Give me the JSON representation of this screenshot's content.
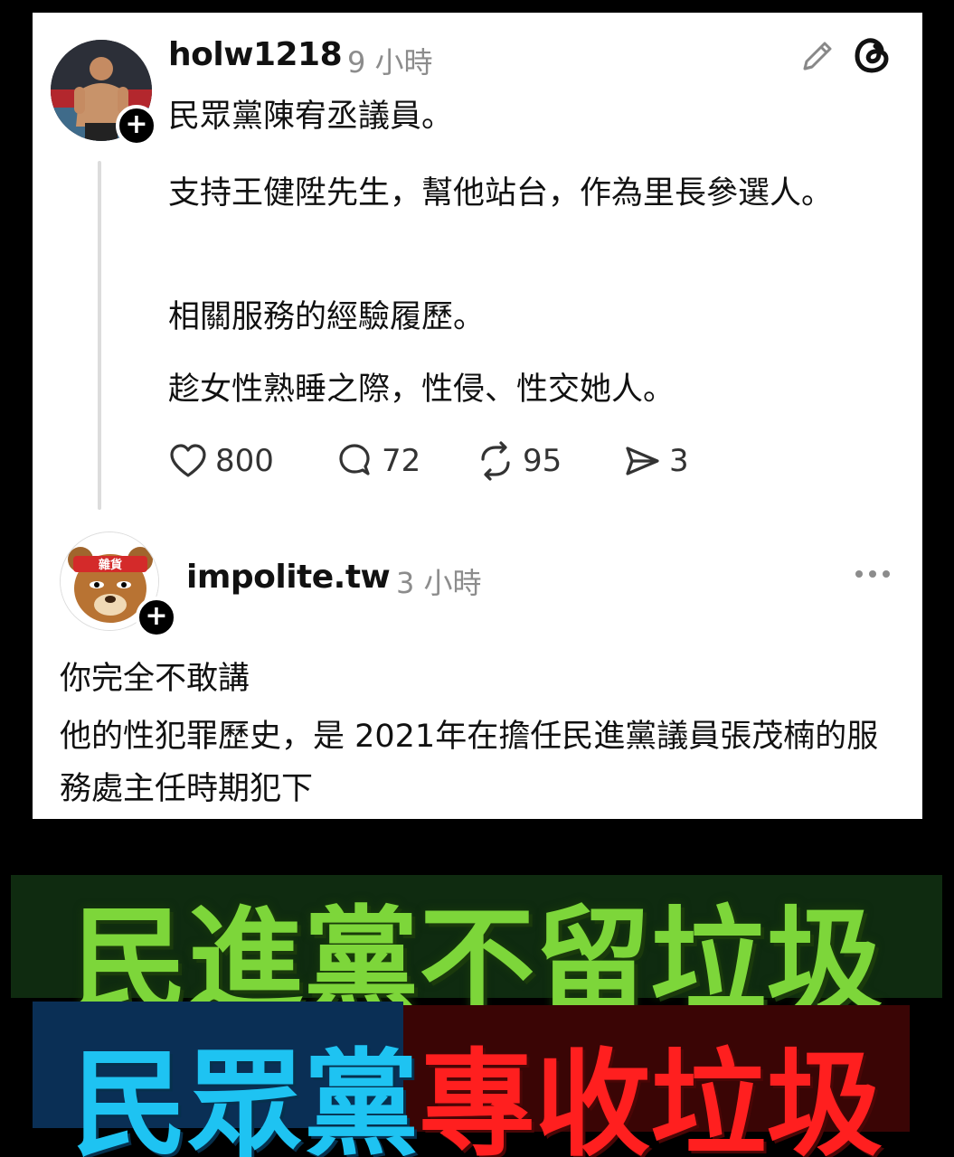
{
  "post": {
    "username": "holw1218",
    "time": "9 小時",
    "lines": [
      "民眾黨陳宥丞議員。",
      "支持王健陞先生，幫他站台，作為里長參選人。",
      "相關服務的經驗履歷。",
      "趁女性熟睡之際，性侵、性交她人。"
    ],
    "likes": "800",
    "comments": "72",
    "reposts": "95",
    "shares": "3"
  },
  "reply": {
    "username": "impolite.tw",
    "time": "3 小時",
    "line1": "你完全不敢講",
    "line2": "他的性犯罪歷史，是 2021年在擔任民進黨議員張茂楠的服務處主任時期犯下",
    "avatar_badge": "雜貨"
  },
  "banner": {
    "line1": "民進黨不留垃圾",
    "line2_blue": "民眾黨",
    "line2_red": "專收垃圾"
  },
  "colors": {
    "green": "#7dd63a",
    "blue": "#1ec3f2",
    "red": "#ff1f1f"
  }
}
